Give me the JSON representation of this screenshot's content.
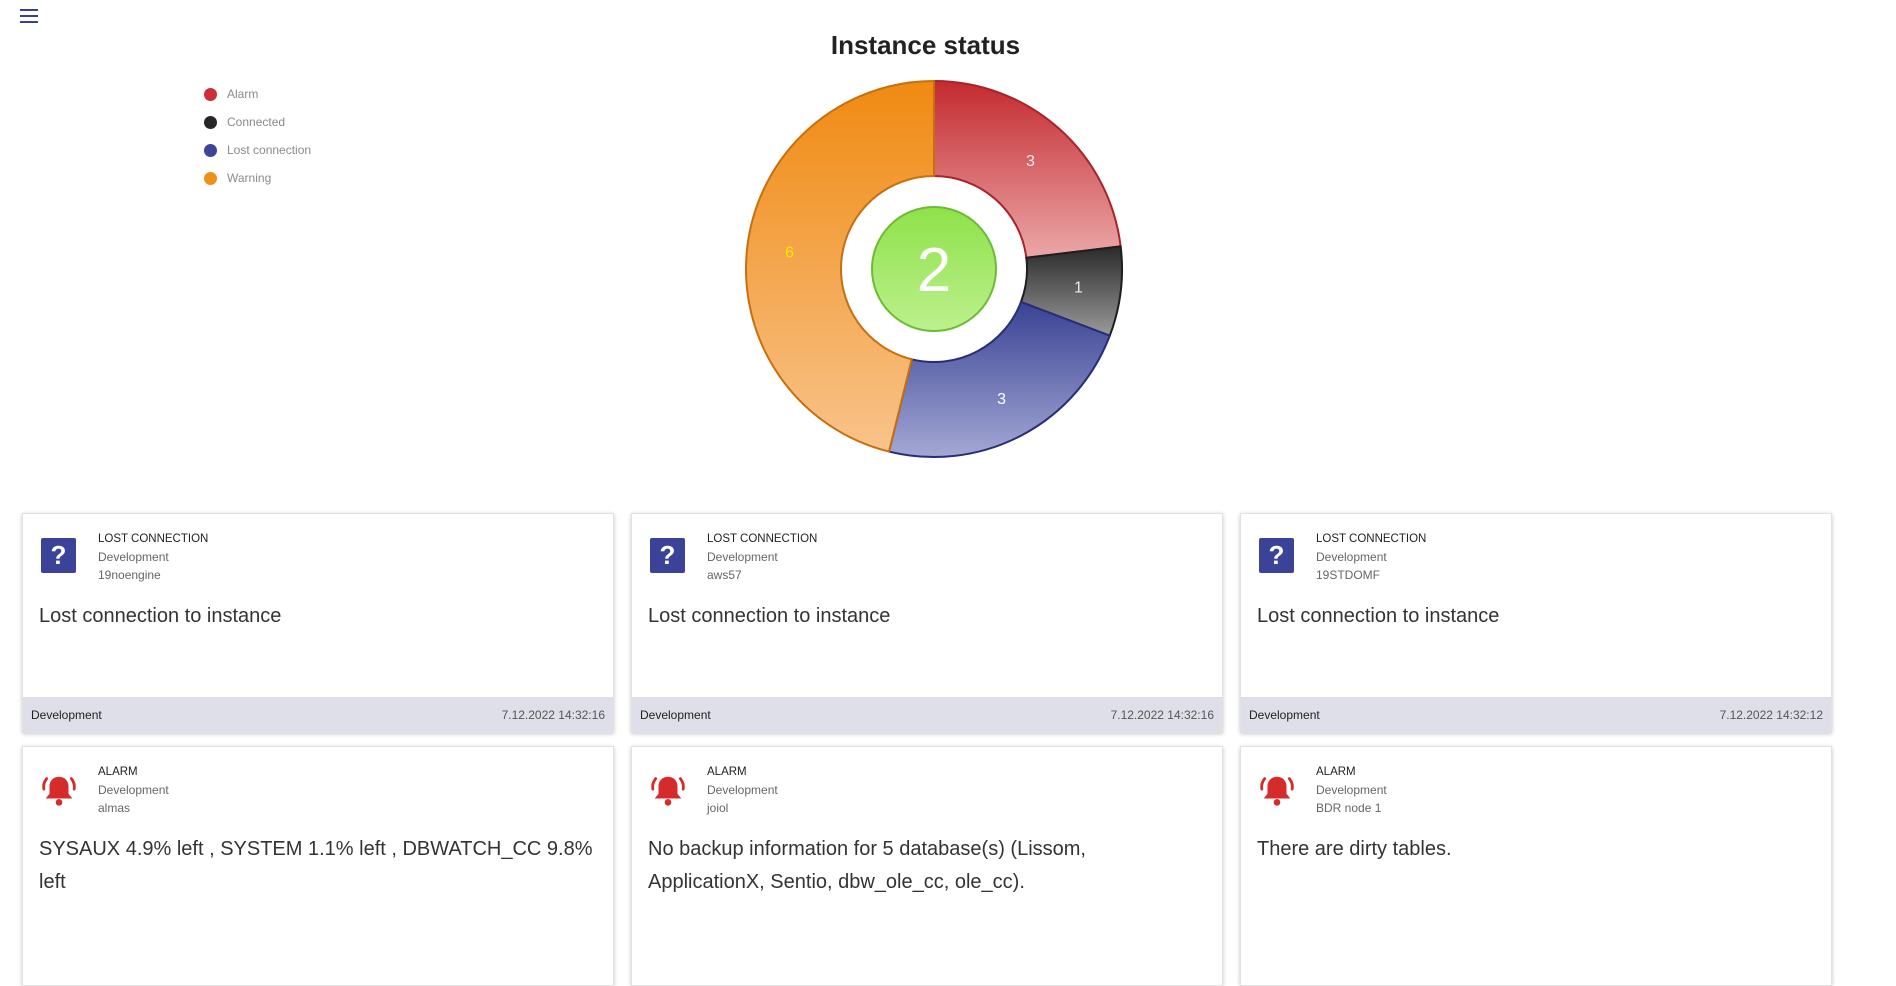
{
  "header": {
    "menu_icon": "hamburger-menu-icon"
  },
  "chart_data": {
    "type": "pie",
    "title": "Instance status",
    "center_value": "2",
    "categories": [
      "Alarm",
      "Connected",
      "Lost connection",
      "Warning"
    ],
    "values": [
      3,
      1,
      3,
      6
    ],
    "colors": [
      "#cc2f36",
      "#333333",
      "#3f4596",
      "#f0901a"
    ],
    "legend_position": "top-left"
  },
  "cards": [
    {
      "type": "lost",
      "icon": "question-icon",
      "status": "LOST CONNECTION",
      "environment": "Development",
      "instance": "19noengine",
      "message": "Lost connection to instance",
      "footer_label": "Development",
      "timestamp": "7.12.2022 14:32:16"
    },
    {
      "type": "lost",
      "icon": "question-icon",
      "status": "LOST CONNECTION",
      "environment": "Development",
      "instance": "aws57",
      "message": "Lost connection to instance",
      "footer_label": "Development",
      "timestamp": "7.12.2022 14:32:16"
    },
    {
      "type": "lost",
      "icon": "question-icon",
      "status": "LOST CONNECTION",
      "environment": "Development",
      "instance": "19STDOMF",
      "message": "Lost connection to instance",
      "footer_label": "Development",
      "timestamp": "7.12.2022 14:32:12"
    },
    {
      "type": "alarm",
      "icon": "bell-icon",
      "status": "ALARM",
      "environment": "Development",
      "instance": "almas",
      "message": "SYSAUX 4.9% left , SYSTEM 1.1% left , DBWATCH_CC 9.8% left"
    },
    {
      "type": "alarm",
      "icon": "bell-icon",
      "status": "ALARM",
      "environment": "Development",
      "instance": "joiol",
      "message": "No backup information for 5 database(s) (Lissom, ApplicationX, Sentio, dbw_ole_cc, ole_cc)."
    },
    {
      "type": "alarm",
      "icon": "bell-icon",
      "status": "ALARM",
      "environment": "Development",
      "instance": "BDR node 1",
      "message": "There are dirty tables."
    }
  ]
}
